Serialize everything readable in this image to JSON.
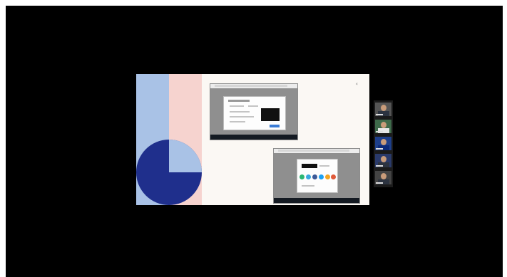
{
  "meeting": {
    "background_color": "#000000",
    "shared_screen": {
      "accent_colors": {
        "blue_band": "#a9c2e6",
        "pink_band": "#f6d3cf",
        "pie_dark": "#1f2f8c",
        "pie_light": "#a9c2e6"
      },
      "close_icon": "close-icon",
      "close_label": "×"
    },
    "participant_thumbnails": [
      {
        "icon": "person-video-icon",
        "bg": "#5a5a5a"
      },
      {
        "icon": "person-video-icon",
        "bg": "#3e6a4a"
      },
      {
        "icon": "person-video-icon",
        "bg": "#1e3f8a"
      },
      {
        "icon": "person-video-icon",
        "bg": "#2a3a6a"
      },
      {
        "icon": "person-video-icon",
        "bg": "#444444"
      }
    ]
  }
}
